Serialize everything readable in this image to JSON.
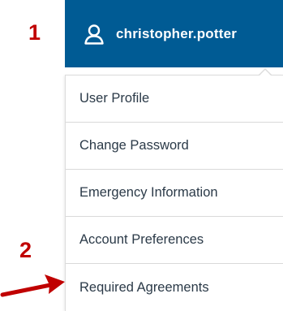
{
  "annotations": {
    "step1": "1",
    "step2": "2",
    "arrow_color": "#c00000"
  },
  "header": {
    "username": "christopher.potter",
    "icon": "user-icon",
    "background": "#005b94"
  },
  "menu": {
    "items": [
      {
        "label": "User Profile"
      },
      {
        "label": "Change Password"
      },
      {
        "label": "Emergency Information"
      },
      {
        "label": "Account Preferences"
      },
      {
        "label": "Required Agreements"
      }
    ]
  }
}
